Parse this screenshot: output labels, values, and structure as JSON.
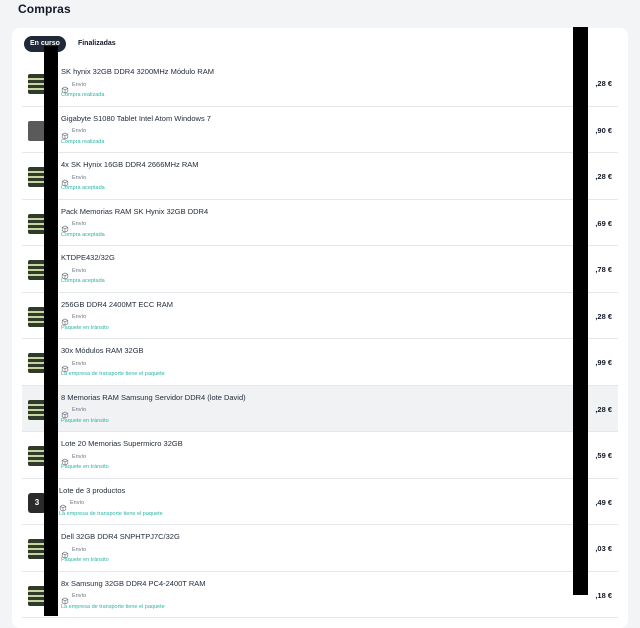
{
  "page": {
    "title": "Compras"
  },
  "tabs": [
    {
      "label": "En curso",
      "active": true
    },
    {
      "label": "Finalizadas",
      "active": false
    }
  ],
  "shipping_label": "Envío",
  "orders": [
    {
      "title": "SK hynix 32GB DDR4 3200MHz Módulo RAM",
      "status": "Compra realizada",
      "price": ",28 €",
      "thumb": "ram-icon"
    },
    {
      "title": "Gigabyte S1080 Tablet Intel Atom Windows 7",
      "status": "Compra realizada",
      "price": ",90 €",
      "thumb": "tablet-icon"
    },
    {
      "title": "4x SK Hynix 16GB DDR4 2666MHz RAM",
      "status": "Compra aceptada",
      "price": ",28 €",
      "thumb": "ram-icon"
    },
    {
      "title": "Pack Memorias RAM SK Hynix 32GB DDR4",
      "status": "Compra aceptada",
      "price": ",69 €",
      "thumb": "ram-icon"
    },
    {
      "title": "KTDPE432/32G",
      "status": "Compra aceptada",
      "price": ",78 €",
      "thumb": "ram-icon"
    },
    {
      "title": "256GB DDR4 2400MT ECC RAM",
      "status": "Paquete en tránsito",
      "price": ",28 €",
      "thumb": "ram-icon"
    },
    {
      "title": "30x Módulos RAM 32GB",
      "status": "La empresa de transporte tiene el paquete",
      "price": ",99 €",
      "thumb": "ram-icon"
    },
    {
      "title": "8 Memorias RAM Samsung Servidor DDR4 (lote David)",
      "status": "Paquete en tránsito",
      "price": ",28 €",
      "thumb": "ram-icon",
      "highlight": true
    },
    {
      "title": "Lote 20 Memorias Supermicro 32GB",
      "status": "Paquete en tránsito",
      "price": ",59 €",
      "thumb": "ram-icon"
    },
    {
      "title": "Lote de 3 productos",
      "status": "La empresa de transporte tiene el paquete",
      "price": ",49 €",
      "thumb": "bundle-count",
      "count": "3"
    },
    {
      "title": "Dell 32GB DDR4 SNPHTPJ7C/32G",
      "status": "Paquete en tránsito",
      "price": ",03 €",
      "thumb": "ram-icon"
    },
    {
      "title": "8x Samsung 32GB DDR4 PC4-2400T RAM",
      "status": "La empresa de transporte tiene el paquete",
      "price": ",18 €",
      "thumb": "ram-icon"
    }
  ],
  "colors": {
    "accent": "#2bb5a3",
    "active_tab": "#1f2937"
  }
}
